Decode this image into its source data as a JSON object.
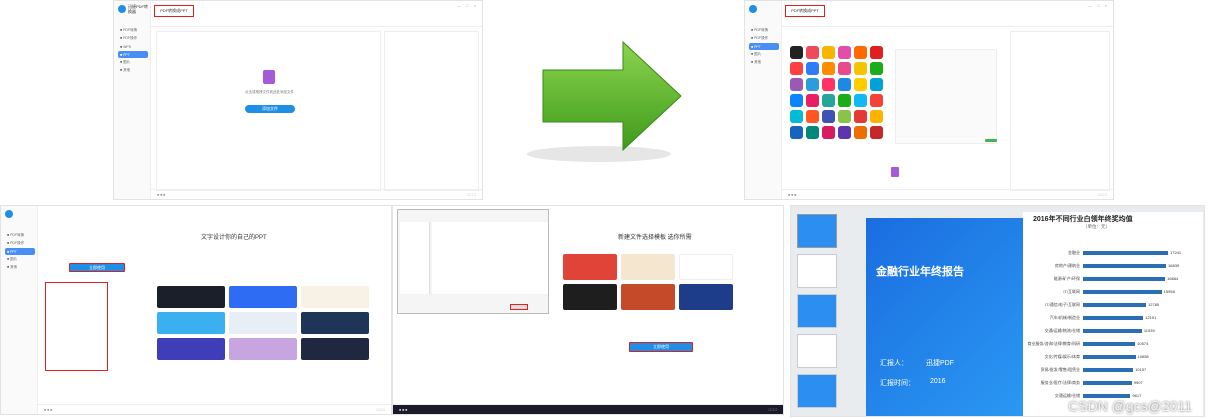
{
  "panels": {
    "p1": {
      "logo_text": "迅捷PDF转换器",
      "tab_label": "PDF转换成PPT",
      "drop_hint": "点击或拖拽文件到此处添加文件",
      "add_button": "添加文件"
    },
    "p2": {
      "tab_label": "PDF转换成PPT"
    },
    "p3": {
      "start_button": "立即使用",
      "heading": "文字设计你的自己的PPT"
    },
    "p4": {
      "heading": "新建文件选择模板 选你所需",
      "use_button": "立即使用"
    },
    "p5": {
      "chart_title": "2016年不同行业白领年终奖均值",
      "chart_unit": "（单位：元）",
      "slide_title": "金融行业年终报告",
      "reporter_label": "汇报人：",
      "reporter_name": "迅捷PDF",
      "date_label": "汇报时间：",
      "date_value": "2016"
    }
  },
  "watermark": "CSDN @gcs@2011",
  "colors": {
    "accent": "#1f8fe6",
    "highlight": "#e02020",
    "arrow_green": "#5cb82c",
    "ppt_blue": "#2a6fb5"
  },
  "chart_data": {
    "type": "bar",
    "title": "2016年不同行业白领年终奖均值",
    "ylabel": "（单位：元）",
    "categories": [
      "金融业",
      "房地产/建筑业",
      "能源/矿产/环保",
      "IT/互联网",
      "IT/通信/电子/互联网",
      "汽车/机械/制造业",
      "交通/运输/物流/仓储",
      "商业服务/咨询/法律/教育/科研",
      "文化/传媒/娱乐/体育",
      "贸易/批发/零售/租赁业",
      "服务业/医疗/法律/商务",
      "交通运输/仓储"
    ],
    "values": [
      17241,
      16839,
      16664,
      15958,
      12785,
      12191,
      11939,
      10574,
      10658,
      10157,
      9907,
      9617
    ]
  }
}
